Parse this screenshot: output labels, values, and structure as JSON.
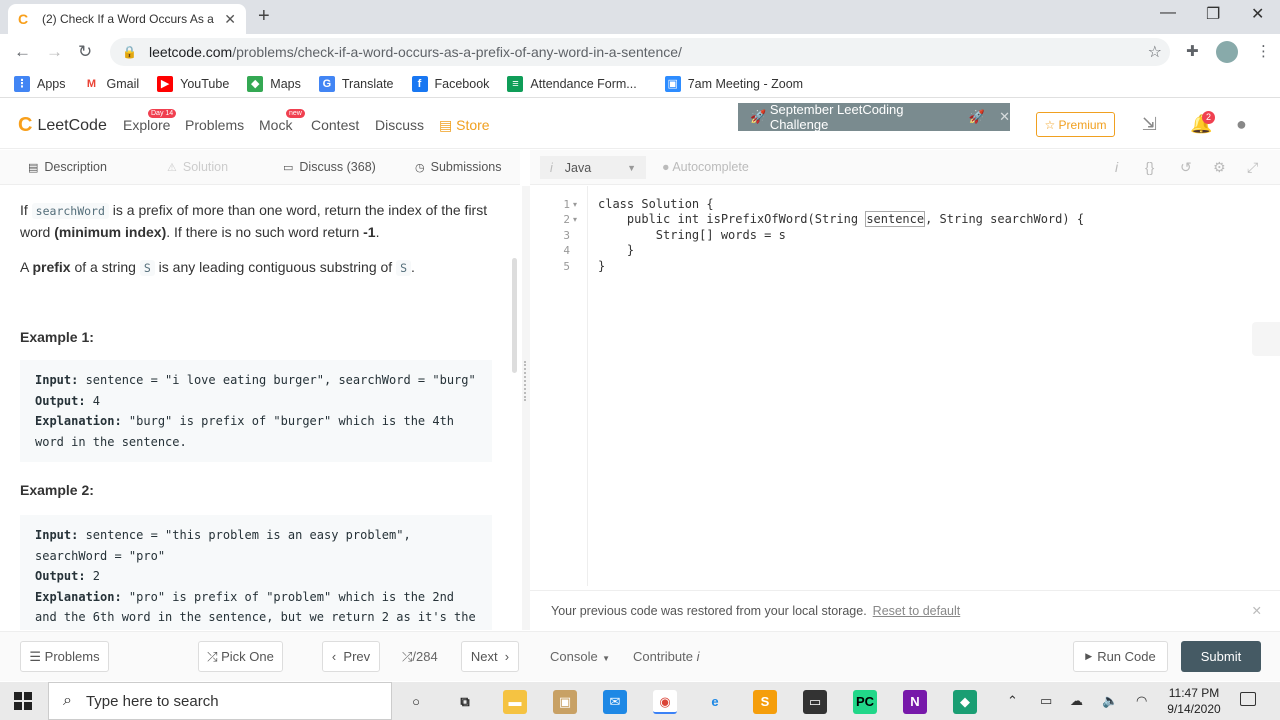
{
  "browser": {
    "tab_title": "(2) Check If a Word Occurs As a P",
    "url_host": "leetcode.com",
    "url_path": "/problems/check-if-a-word-occurs-as-a-prefix-of-any-word-in-a-sentence/",
    "bookmarks": [
      {
        "label": "Apps",
        "icon": "apps-grid-icon",
        "color": "#4285f4"
      },
      {
        "label": "Gmail",
        "icon": "gmail-icon",
        "color": "#ea4335"
      },
      {
        "label": "YouTube",
        "icon": "youtube-icon",
        "color": "#ff0000"
      },
      {
        "label": "Maps",
        "icon": "maps-icon",
        "color": "#34a853"
      },
      {
        "label": "Translate",
        "icon": "translate-icon",
        "color": "#4285f4"
      },
      {
        "label": "Facebook",
        "icon": "facebook-icon",
        "color": "#1877f2"
      },
      {
        "label": "Attendance Form...",
        "icon": "forms-icon",
        "color": "#0f9d58"
      },
      {
        "label": "7am Meeting - Zoom",
        "icon": "zoom-icon",
        "color": "#2d8cff"
      }
    ]
  },
  "leetcode": {
    "logo_text": "LeetCode",
    "nav": {
      "explore": "Explore",
      "explore_badge": "Day 14",
      "problems": "Problems",
      "mock": "Mock",
      "mock_badge": "new",
      "contest": "Contest",
      "discuss": "Discuss",
      "store": "Store"
    },
    "challenge_banner": "September LeetCoding Challenge",
    "premium": "Premium",
    "notification_count": "2",
    "accent_color": "#f89f1b"
  },
  "left_tabs": {
    "description": "Description",
    "solution": "Solution",
    "discuss": "Discuss (368)",
    "submissions": "Submissions"
  },
  "problem": {
    "para1_a": "If ",
    "para1_code": "searchWord",
    "para1_b": " is a prefix of more than one word, return the index of the first word ",
    "para1_bold": "(minimum index)",
    "para1_c": ". If there is no such word return ",
    "para1_bold2": "-1",
    "para1_d": ".",
    "para2_a": "A ",
    "para2_bold": "prefix",
    "para2_b": " of a string ",
    "para2_code": "S",
    "para2_c": " is any leading contiguous substring of ",
    "para2_code2": "S",
    "para2_d": ".",
    "example1_title": "Example 1:",
    "example1": {
      "input_label": "Input:",
      "input": " sentence = \"i love eating burger\", searchWord = \"burg\"",
      "output_label": "Output:",
      "output": " 4",
      "explanation_label": "Explanation:",
      "explanation_line1": " \"burg\" is prefix of \"burger\" which is the 4th",
      "explanation_line2": "word in the sentence."
    },
    "example2_title": "Example 2:",
    "example2": {
      "input_label": "Input:",
      "input_line1": " sentence = \"this problem is an easy problem\",",
      "input_line2": "searchWord = \"pro\"",
      "output_label": "Output:",
      "output": " 2",
      "explanation_label": "Explanation:",
      "explanation_line1": " \"pro\" is prefix of \"problem\" which is the 2nd",
      "explanation_line2": "and the 6th word in the sentence, but we return 2 as it's the"
    }
  },
  "editor": {
    "language": "Java",
    "autocomplete": "Autocomplete",
    "lines": [
      {
        "num": "1",
        "fold": "▾",
        "a": "class Solution {",
        "hl": "",
        "b": ""
      },
      {
        "num": "2",
        "fold": "▾",
        "a": "    public int isPrefixOfWord(String ",
        "hl": "sentence",
        "b": ", String searchWord) {"
      },
      {
        "num": "3",
        "fold": "",
        "a": "        String[] words = s",
        "hl": "",
        "b": ""
      },
      {
        "num": "4",
        "fold": "",
        "a": "    }",
        "hl": "",
        "b": ""
      },
      {
        "num": "5",
        "fold": "",
        "a": "}",
        "hl": "",
        "b": ""
      }
    ],
    "restore_msg": "Your previous code was restored from your local storage.",
    "reset_link": "Reset to default"
  },
  "bottom": {
    "problems": "Problems",
    "pick_one": "Pick One",
    "prev": "Prev",
    "counter": "/284",
    "next": "Next",
    "console": "Console",
    "contribute": "Contribute",
    "run_code": "Run Code",
    "submit": "Submit"
  },
  "taskbar": {
    "search_placeholder": "Type here to search",
    "time": "11:47 PM",
    "date": "9/14/2020"
  }
}
